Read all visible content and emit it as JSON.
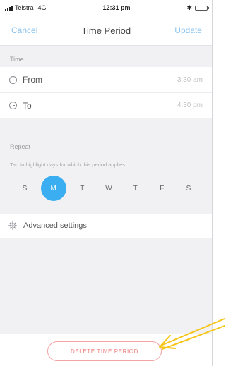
{
  "status_bar": {
    "carrier": "Telstra",
    "network": "4G",
    "time": "12:31 pm",
    "bluetooth": "✱",
    "battery_level": 1.0
  },
  "nav": {
    "cancel_label": "Cancel",
    "title": "Time Period",
    "update_label": "Update"
  },
  "time_section": {
    "header": "Time",
    "rows": [
      {
        "label": "From",
        "value": "3:30 am",
        "icon": "clock-icon"
      },
      {
        "label": "To",
        "value": "4:30 pm",
        "icon": "clock-icon"
      }
    ]
  },
  "repeat_section": {
    "header": "Repeat",
    "hint": "Tap to highlight days for which this period applies",
    "days": [
      "S",
      "M",
      "T",
      "W",
      "T",
      "F",
      "S"
    ],
    "selected_day_index": 1
  },
  "advanced": {
    "label": "Advanced settings",
    "icon": "gear-icon"
  },
  "delete": {
    "label": "DELETE TIME PERIOD"
  },
  "annotation": {
    "arrow_color": "#f5c518"
  },
  "colors": {
    "accent": "#3aaef0",
    "nav_button": "#8cc4ef",
    "delete": "#f07b7b"
  }
}
